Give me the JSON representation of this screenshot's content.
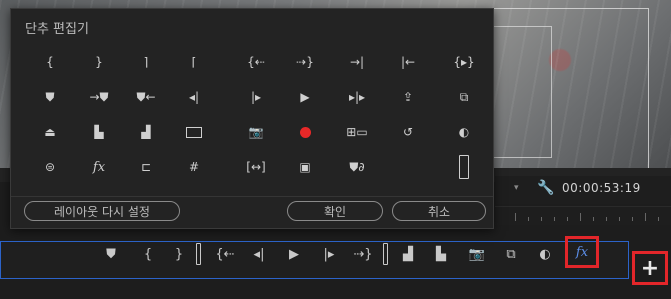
{
  "dialog": {
    "title": "단추 편집기",
    "buttons": {
      "reset": "레이아웃 다시 설정",
      "ok": "확인",
      "cancel": "취소"
    },
    "rows": [
      [
        {
          "icon": "mark-in-icon",
          "glyph": "{"
        },
        {
          "icon": "mark-out-icon",
          "glyph": "}"
        },
        {
          "icon": "clear-in-icon",
          "glyph": "⌉"
        },
        {
          "icon": "clear-out-icon",
          "glyph": "⌈"
        },
        {
          "icon": "go-to-in-icon",
          "glyph": "{⇠"
        },
        {
          "icon": "go-to-out-icon",
          "glyph": "⇢}"
        },
        {
          "icon": "go-to-next-edit-icon",
          "glyph": "→|"
        },
        {
          "icon": "go-to-prev-edit-icon",
          "glyph": "|←"
        },
        {
          "icon": "play-in-to-out-icon",
          "glyph": "{▸}"
        }
      ],
      [
        {
          "icon": "add-marker-icon",
          "glyph": "⛊"
        },
        {
          "icon": "go-to-next-marker-icon",
          "glyph": "→⛊"
        },
        {
          "icon": "go-to-prev-marker-icon",
          "glyph": "⛊←"
        },
        {
          "icon": "step-back-icon",
          "glyph": "◂|"
        },
        {
          "icon": "step-forward-icon",
          "glyph": "|▸"
        },
        {
          "icon": "play-icon",
          "glyph": "▶"
        },
        {
          "icon": "trim-monitor-icon",
          "glyph": "▸|▸"
        },
        {
          "icon": "export-frame-icon",
          "glyph": "⇪"
        },
        {
          "icon": "multi-camera-icon",
          "glyph": "⧉"
        }
      ],
      [
        {
          "icon": "lift-icon",
          "glyph": "⏏"
        },
        {
          "icon": "overwrite-icon",
          "glyph": "▙"
        },
        {
          "icon": "insert-icon",
          "glyph": "▟"
        },
        {
          "icon": "safe-margins-icon",
          "glyph": "rect"
        },
        {
          "icon": "camera-icon",
          "glyph": "📷"
        },
        {
          "icon": "record-icon",
          "glyph": "dot"
        },
        {
          "icon": "compare-view-icon",
          "glyph": "⊞▭"
        },
        {
          "icon": "loop-icon",
          "glyph": "↺"
        },
        {
          "icon": "toggle-proxies-icon",
          "glyph": "◐"
        }
      ],
      [
        {
          "icon": "vr-video-icon",
          "glyph": "⊜"
        },
        {
          "icon": "fx-icon",
          "glyph": "fx"
        },
        {
          "icon": "comparison-frame-icon",
          "glyph": "⊏"
        },
        {
          "icon": "multi-track-icon",
          "glyph": "#"
        },
        {
          "icon": "fit-frame-icon",
          "glyph": "[↔]"
        },
        {
          "icon": "global-fx-mute-icon",
          "glyph": "▣"
        },
        {
          "icon": "marker-link-icon",
          "glyph": "⛊∂"
        },
        {
          "icon": "spacer-icon",
          "glyph": ""
        },
        {
          "icon": "tall-spacer-icon",
          "glyph": "tall"
        }
      ]
    ]
  },
  "monitor": {
    "timecode": "00:00:53:19"
  },
  "button_bar": {
    "items": [
      {
        "icon": "add-marker-icon",
        "glyph": "⛊"
      },
      {
        "icon": "mark-in-icon",
        "glyph": "{"
      },
      {
        "icon": "mark-out-icon",
        "glyph": "}"
      },
      {
        "icon": "spacer-bar-icon",
        "glyph": "bar"
      },
      {
        "icon": "go-to-in-icon",
        "glyph": "{⇠"
      },
      {
        "icon": "step-back-icon",
        "glyph": "◂|"
      },
      {
        "icon": "play-icon",
        "glyph": "▶"
      },
      {
        "icon": "step-forward-icon",
        "glyph": "|▸"
      },
      {
        "icon": "go-to-out-icon",
        "glyph": "⇢}"
      },
      {
        "icon": "spacer-bar-icon",
        "glyph": "bar"
      },
      {
        "icon": "insert-icon",
        "glyph": "▟"
      },
      {
        "icon": "overwrite-icon",
        "glyph": "▙"
      },
      {
        "icon": "camera-icon",
        "glyph": "📷"
      },
      {
        "icon": "multi-camera-icon",
        "glyph": "⧉"
      },
      {
        "icon": "toggle-proxies-icon",
        "glyph": "◐"
      }
    ],
    "fx_label": "fx",
    "add_label": "+"
  },
  "colors": {
    "accent_blue": "#2c63c9",
    "highlight_red": "#e2262a",
    "record_red": "#e82828",
    "fx_blue": "#5c8ee8"
  }
}
